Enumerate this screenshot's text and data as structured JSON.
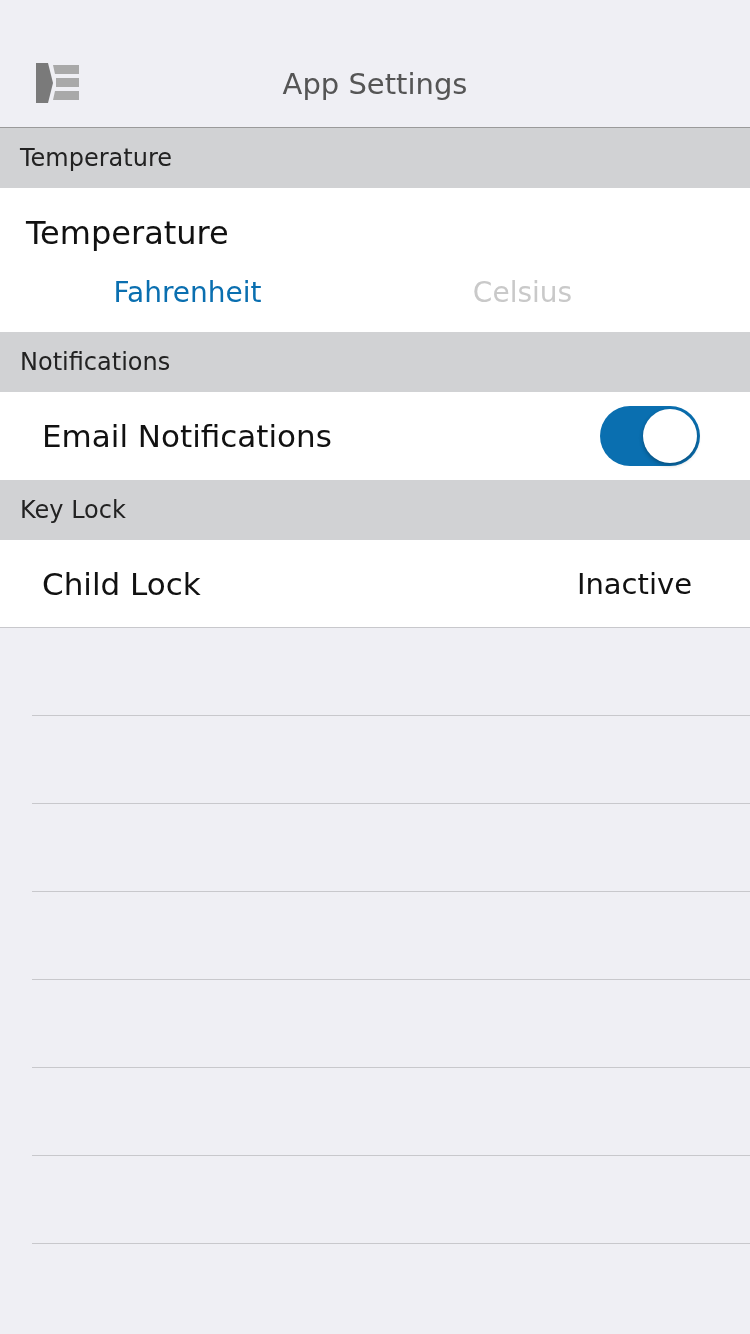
{
  "header": {
    "title": "App Settings"
  },
  "sections": [
    {
      "kind": "segmented",
      "title": "Temperature",
      "label": "Temperature",
      "options": [
        {
          "label": "Fahrenheit",
          "selected": true
        },
        {
          "label": "Celsius",
          "selected": false
        }
      ]
    },
    {
      "kind": "toggle",
      "title": "Notifications",
      "rows": [
        {
          "label": "Email Notifications",
          "on": true
        }
      ]
    },
    {
      "kind": "value",
      "title": "Key Lock",
      "rows": [
        {
          "label": "Child Lock",
          "value": "Inactive"
        }
      ]
    }
  ]
}
